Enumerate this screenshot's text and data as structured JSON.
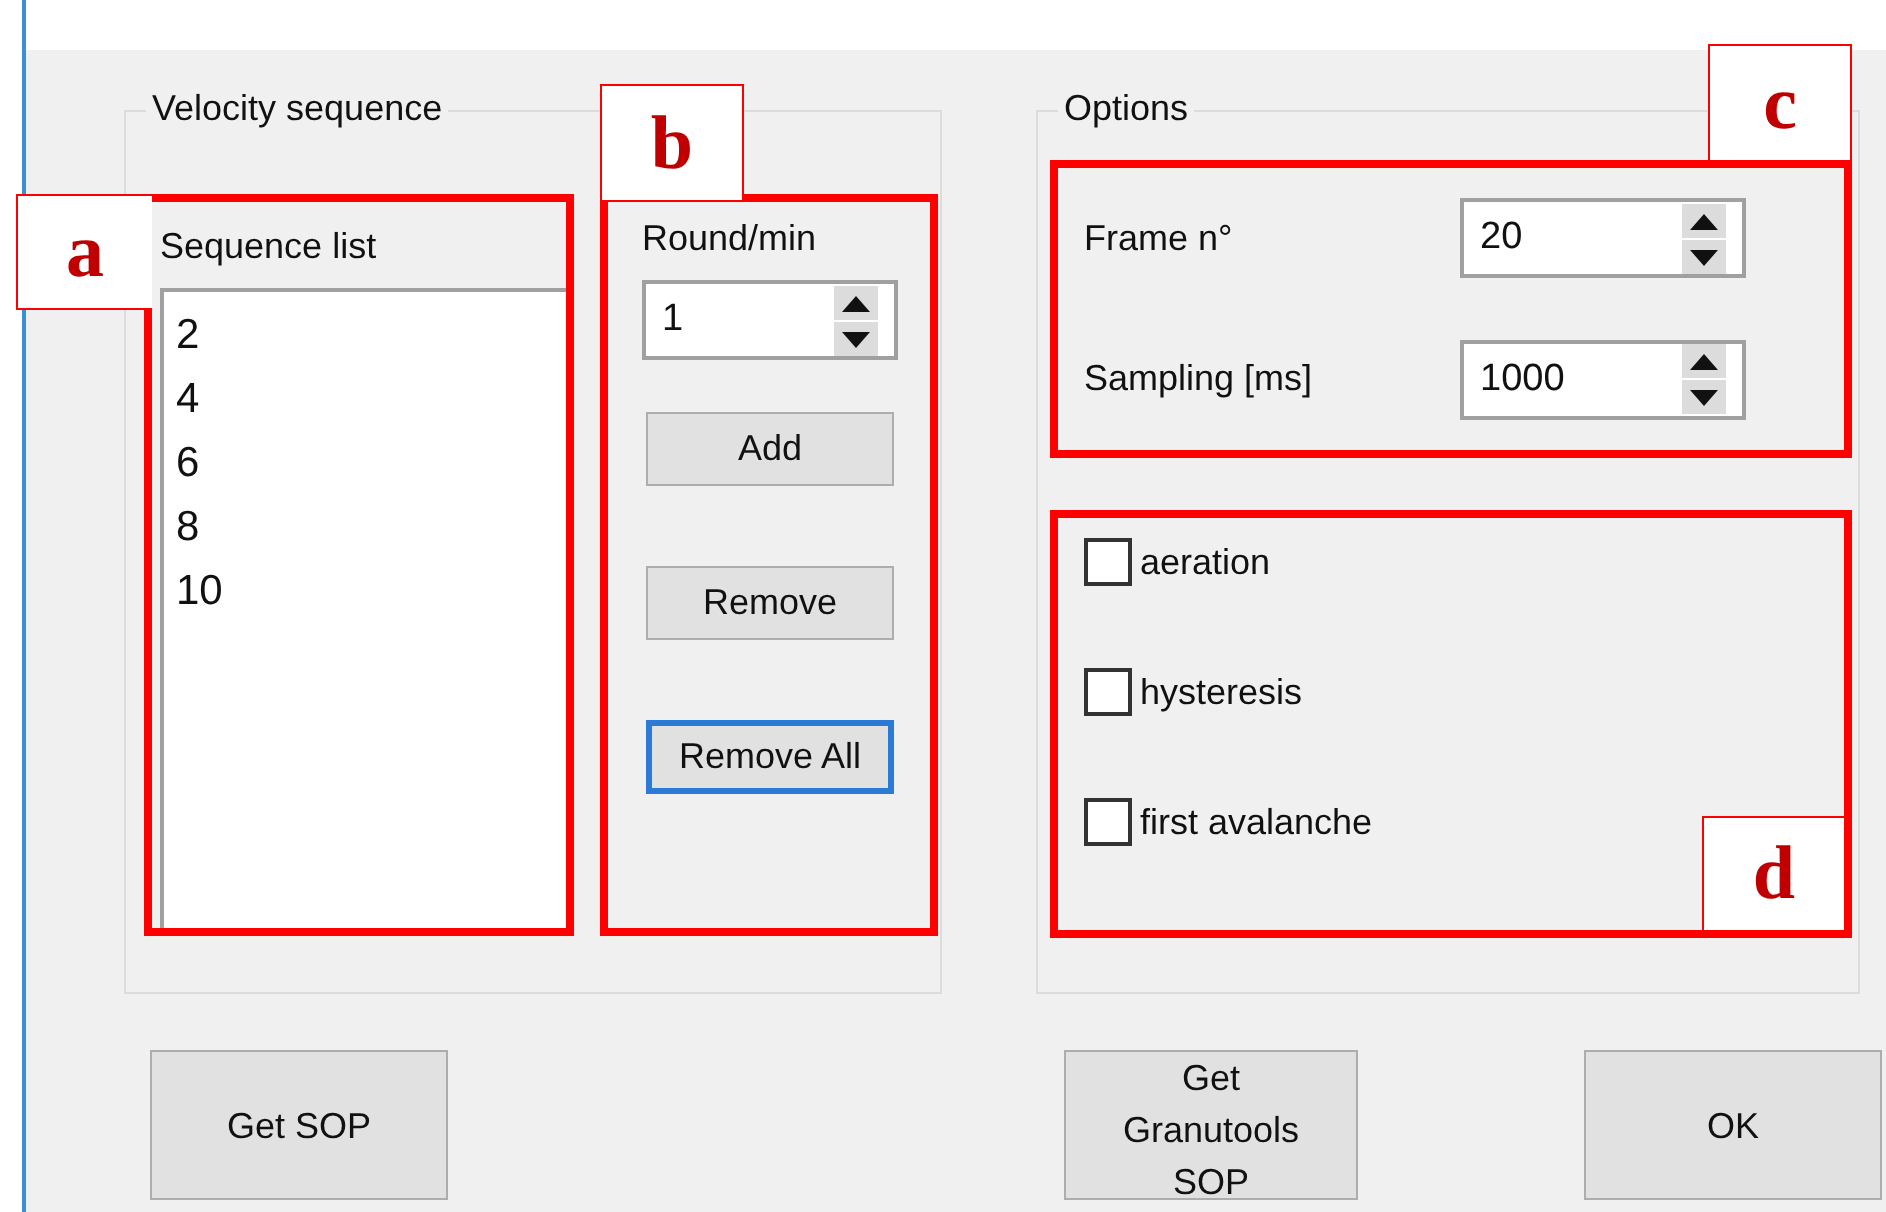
{
  "velocity_sequence": {
    "title": "Velocity sequence",
    "sequence_list": {
      "label": "Sequence list",
      "items": [
        "2",
        "4",
        "6",
        "8",
        "10"
      ]
    },
    "round_per_min": {
      "label": "Round/min",
      "value": "1"
    },
    "buttons": [
      {
        "label": "Add",
        "focused": false
      },
      {
        "label": "Remove",
        "focused": false
      },
      {
        "label": "Remove All",
        "focused": true
      }
    ]
  },
  "options": {
    "title": "Options",
    "fields": [
      {
        "label": "Frame n°",
        "value": "20"
      },
      {
        "label": "Sampling [ms]",
        "value": "1000"
      }
    ],
    "checkboxes": [
      {
        "label": "aeration",
        "checked": false
      },
      {
        "label": "hysteresis",
        "checked": false
      },
      {
        "label": "first avalanche",
        "checked": false
      }
    ]
  },
  "footer_buttons": [
    {
      "label": "Get SOP"
    },
    {
      "label": "Get Granutools SOP"
    },
    {
      "label": "OK"
    }
  ],
  "annotations": [
    "a",
    "b",
    "c",
    "d"
  ]
}
